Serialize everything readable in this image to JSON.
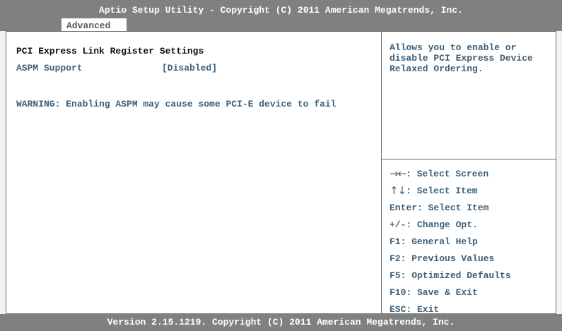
{
  "header": {
    "title": "Aptio Setup Utility - Copyright (C) 2011 American Megatrends, Inc.",
    "tabs": [
      {
        "label": "Advanced"
      }
    ]
  },
  "main": {
    "section_title": "PCI Express Link Register Settings",
    "aspm_label": "ASPM Support",
    "aspm_value": "[Disabled]",
    "warning": "WARNING: Enabling ASPM may cause some PCI-E device to fail"
  },
  "help": {
    "text": "Allows you to enable or disable PCI Express Device Relaxed Ordering."
  },
  "keys": [
    {
      "glyph": "→←",
      "label": ": Select Screen",
      "glyph_icon": "left-right-arrows-icon"
    },
    {
      "glyph": "↑↓",
      "label": ": Select Item",
      "glyph_icon": "up-down-arrows-icon"
    },
    {
      "label": "Enter: Select Item"
    },
    {
      "label": "+/-: Change Opt."
    },
    {
      "label": "F1: General Help"
    },
    {
      "label": "F2: Previous Values"
    },
    {
      "label": "F5: Optimized Defaults"
    },
    {
      "label": "F10: Save & Exit"
    },
    {
      "label": "ESC: Exit"
    }
  ],
  "footer": {
    "text": "Version 2.15.1219. Copyright (C) 2011 American Megatrends, Inc."
  },
  "colors": {
    "bar": "#808080",
    "panel": "#ffffff",
    "item_text": "#3d5f78",
    "heading_text": "#111111"
  }
}
